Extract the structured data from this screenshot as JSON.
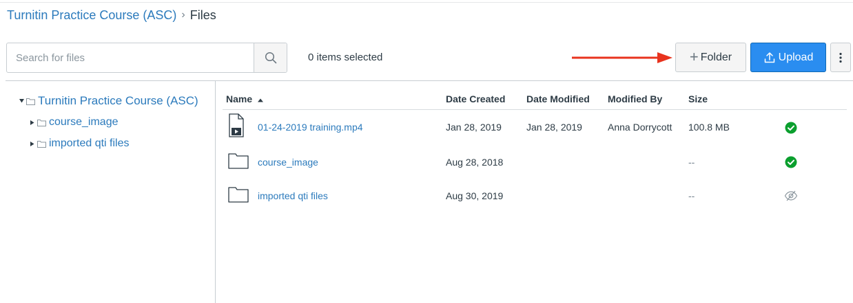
{
  "breadcrumb": {
    "course": "Turnitin Practice Course (ASC)",
    "separator": "›",
    "current": "Files"
  },
  "toolbar": {
    "search_placeholder": "Search for files",
    "selected_count": "0 items selected",
    "folder_label": "Folder",
    "upload_label": "Upload"
  },
  "tree": {
    "root": "Turnitin Practice Course (ASC)",
    "children": [
      {
        "label": "course_image"
      },
      {
        "label": "imported qti files"
      }
    ]
  },
  "table": {
    "columns": {
      "name": "Name",
      "date_created": "Date Created",
      "date_modified": "Date Modified",
      "modified_by": "Modified By",
      "size": "Size"
    },
    "rows": [
      {
        "name": "01-24-2019 training.mp4",
        "date_created": "Jan 28, 2019",
        "date_modified": "Jan 28, 2019",
        "modified_by": "Anna Dorrycott",
        "size": "100.8 MB",
        "icon": "video-file-icon",
        "status": "published"
      },
      {
        "name": "course_image",
        "date_created": "Aug 28, 2018",
        "date_modified": "",
        "modified_by": "",
        "size": "--",
        "icon": "folder-icon",
        "status": "published"
      },
      {
        "name": "imported qti files",
        "date_created": "Aug 30, 2019",
        "date_modified": "",
        "modified_by": "",
        "size": "--",
        "icon": "folder-icon",
        "status": "hidden"
      }
    ]
  },
  "colors": {
    "link": "#2b7abc",
    "upload_bg": "#2a8df0",
    "published": "#0b9f2e",
    "arrow": "#e8331e",
    "text": "#2d3b45"
  }
}
